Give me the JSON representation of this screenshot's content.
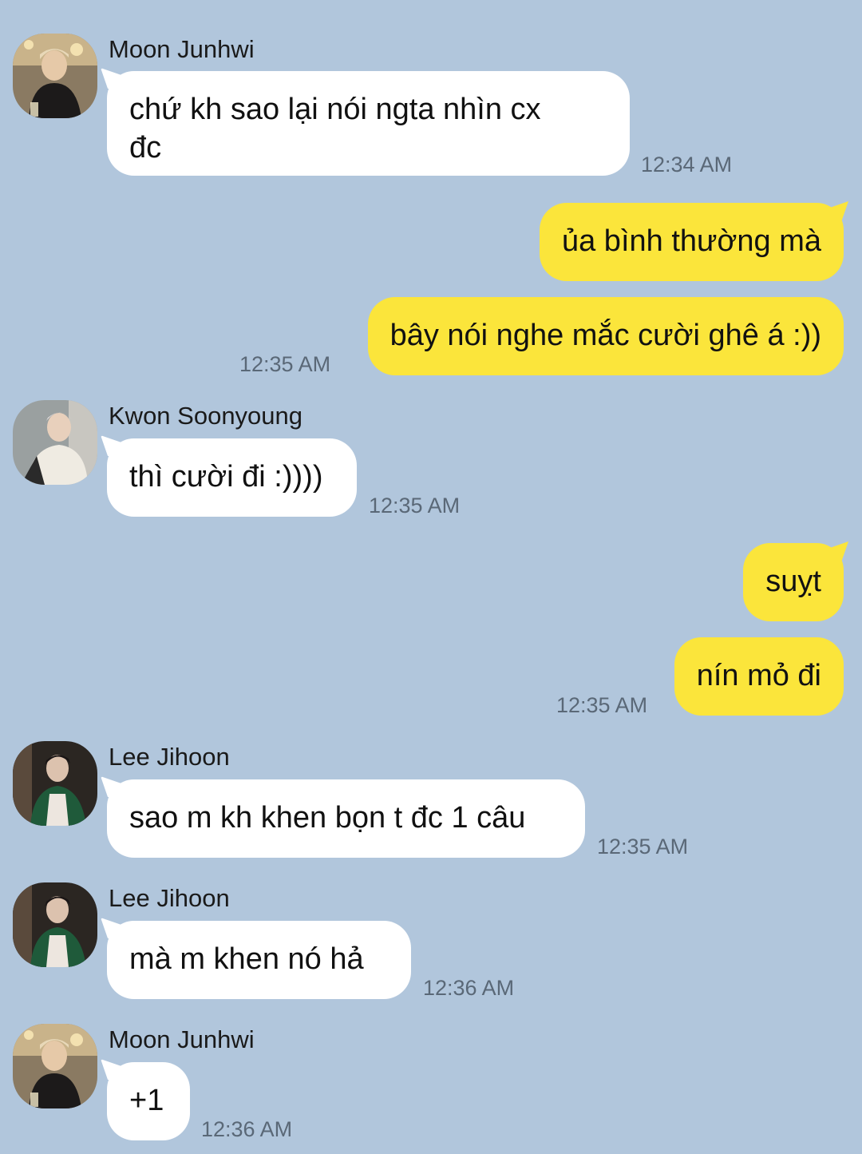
{
  "colors": {
    "background": "#b1c6dc",
    "incoming_bubble": "#ffffff",
    "outgoing_bubble": "#fbe53b",
    "timestamp": "#5a6877"
  },
  "messages": [
    {
      "sender": "Moon Junhwi",
      "text": "chứ kh sao lại nói ngta nhìn cx\nđc",
      "time": "12:34 AM",
      "avatar_icon": "profile-photo"
    },
    {
      "text": "ủa bình thường mà"
    },
    {
      "text": "bây nói nghe mắc cười ghê á :))",
      "time": "12:35 AM"
    },
    {
      "sender": "Kwon Soonyoung",
      "text": "thì cười đi :))))",
      "time": "12:35 AM",
      "avatar_icon": "profile-photo"
    },
    {
      "text": "suỵt"
    },
    {
      "text": "nín mỏ đi",
      "time": "12:35 AM"
    },
    {
      "sender": "Lee Jihoon",
      "text": "sao m kh khen bọn t đc 1 câu",
      "time": "12:35 AM",
      "avatar_icon": "profile-photo"
    },
    {
      "sender": "Lee Jihoon",
      "text": "mà m khen nó hả",
      "time": "12:36 AM",
      "avatar_icon": "profile-photo"
    },
    {
      "sender": "Moon Junhwi",
      "text": "+1",
      "time": "12:36 AM",
      "avatar_icon": "profile-photo"
    }
  ]
}
